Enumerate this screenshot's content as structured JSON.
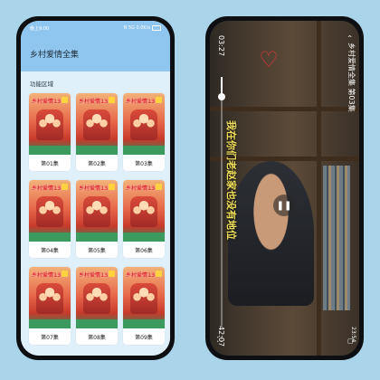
{
  "left": {
    "status_time": "晚上9:00",
    "status_right": "N 5G 0.0K/s",
    "app_title": "乡村爱情全集",
    "section_label": "功能区域",
    "poster_title": "乡村爱情13",
    "episodes": [
      "第01集",
      "第02集",
      "第03集",
      "第04集",
      "第05集",
      "第06集",
      "第07集",
      "第08集",
      "第09集"
    ]
  },
  "right": {
    "current_time": "03:27",
    "total_time": "42:07",
    "progress_fraction": 0.08,
    "title": "乡村爱情全集 第03集",
    "subtitle": "我在你们老赵家也没有地位",
    "clock": "23:54"
  },
  "colors": {
    "background": "#a9d4ea",
    "appbar": "#8ec6f0",
    "subtitle": "#f1e05a"
  },
  "icons": {
    "back": "chevron-left-icon",
    "pause": "pause-icon",
    "fullscreen": "fullscreen-icon"
  }
}
